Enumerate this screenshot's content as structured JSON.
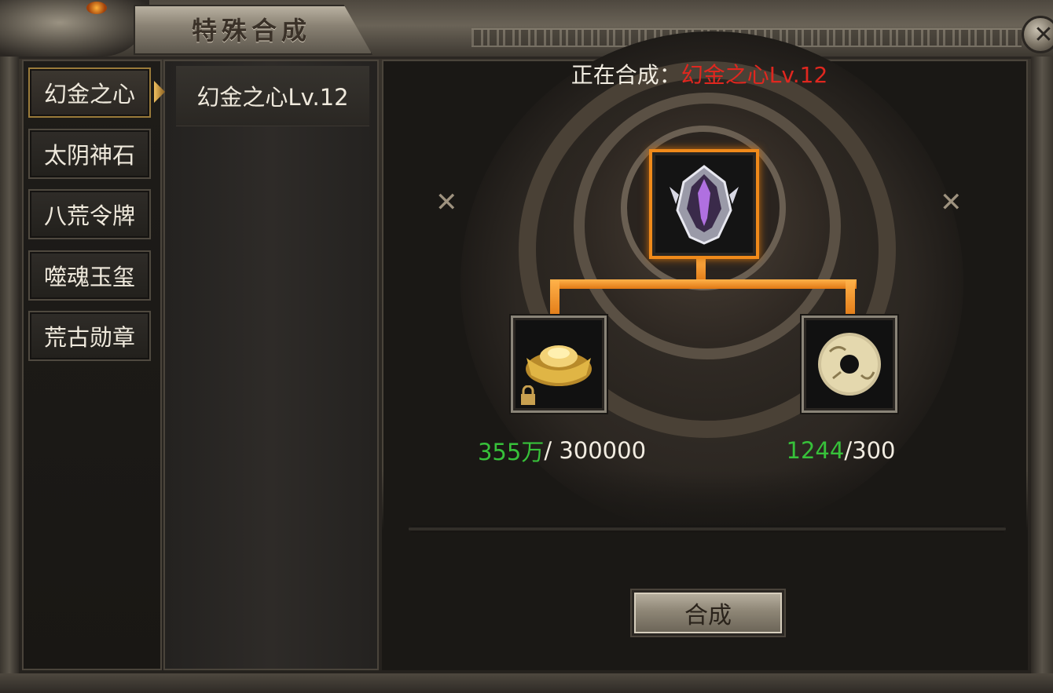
{
  "window": {
    "title": "特殊合成",
    "close_icon": "close-icon"
  },
  "categories": [
    {
      "label": "幻金之心",
      "active": true
    },
    {
      "label": "太阴神石",
      "active": false
    },
    {
      "label": "八荒令牌",
      "active": false
    },
    {
      "label": "噬魂玉玺",
      "active": false
    },
    {
      "label": "荒古勋章",
      "active": false
    }
  ],
  "recipes": [
    {
      "label": "幻金之心Lv.12"
    }
  ],
  "synthesis": {
    "prefix": "正在合成：",
    "target_name": "幻金之心Lv.12",
    "target_icon": "helmet-icon",
    "materials": [
      {
        "icon": "gold-ingot-icon",
        "locked": true,
        "have": "355万",
        "need": "/ 300000"
      },
      {
        "icon": "jade-disc-icon",
        "locked": false,
        "have": "1244",
        "need": "/300"
      }
    ],
    "button_label": "合成"
  },
  "colors": {
    "target_name": "#e0271f",
    "have_count": "#37c13a",
    "connector": "#f08a1a"
  }
}
